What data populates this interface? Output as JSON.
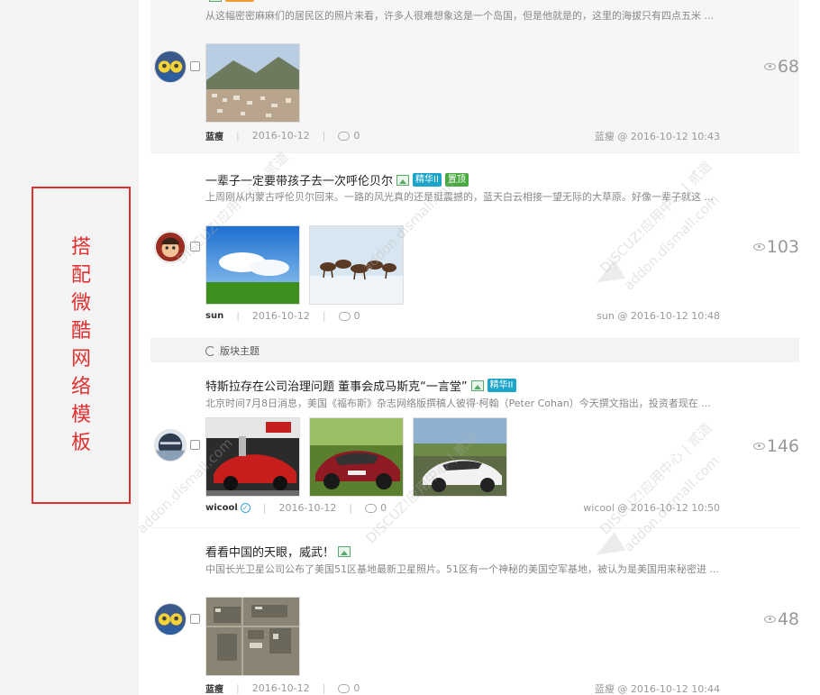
{
  "sidebar": {
    "label_chars": [
      "搭",
      "配",
      "微",
      "酷",
      "网",
      "络",
      "模",
      "板"
    ]
  },
  "watermark": {
    "line1": "DISCUZ!应用中心 | 贰道",
    "line2": "addon.dismall.com"
  },
  "posts": [
    {
      "title": "",
      "summary": "从这幅密密麻麻们的居民区的照片来看，许多人很难想象这是一个岛国，但是他就是的，这里的海拔只有四点五米 ...",
      "author": "蓝瘦",
      "date": "2016-10-12",
      "comments": "0",
      "lastpost": "蓝瘦 @ 2016-10-12 10:43",
      "views": "68"
    },
    {
      "title": "一辈子一定要带孩子去一次呼伦贝尔",
      "badges": [
        "精华II",
        "置顶"
      ],
      "summary": "上周刚从内蒙古呼伦贝尔回来。一路的风光真的还是挺震撼的，蓝天白云相接一望无际的大草原。好像一辈子就这 ...",
      "author": "sun",
      "date": "2016-10-12",
      "comments": "0",
      "lastpost": "sun @ 2016-10-12 10:48",
      "views": "103"
    },
    {
      "title": "特斯拉存在公司治理问题 董事会成马斯克“一言堂”",
      "badges": [
        "精华II"
      ],
      "summary": "北京时间7月8日消息，美国《福布斯》杂志网络版撰稿人彼得·柯翰（Peter Cohan）今天撰文指出，投资者现在 ...",
      "author": "wicool",
      "date": "2016-10-12",
      "comments": "0",
      "lastpost": "wicool @ 2016-10-12 10:50",
      "views": "146"
    },
    {
      "title": "看看中国的天眼，威武！",
      "summary": "中国长光卫星公司公布了美国51区基地最新卫星照片。51区有一个神秘的美国空军基地，被认为是美国用来秘密进 ...",
      "author": "蓝瘦",
      "date": "2016-10-12",
      "comments": "0",
      "lastpost": "蓝瘦 @ 2016-10-12 10:44",
      "views": "48"
    }
  ],
  "section": {
    "label": "版块主题"
  },
  "icons": {
    "views": "eye-icon",
    "comments": "comment-icon",
    "refresh": "refresh-icon",
    "image": "image-icon"
  },
  "colors": {
    "accent_red": "#e03030",
    "badge_jinghua": "#1aa5c9",
    "badge_zhiding": "#4aa941"
  }
}
